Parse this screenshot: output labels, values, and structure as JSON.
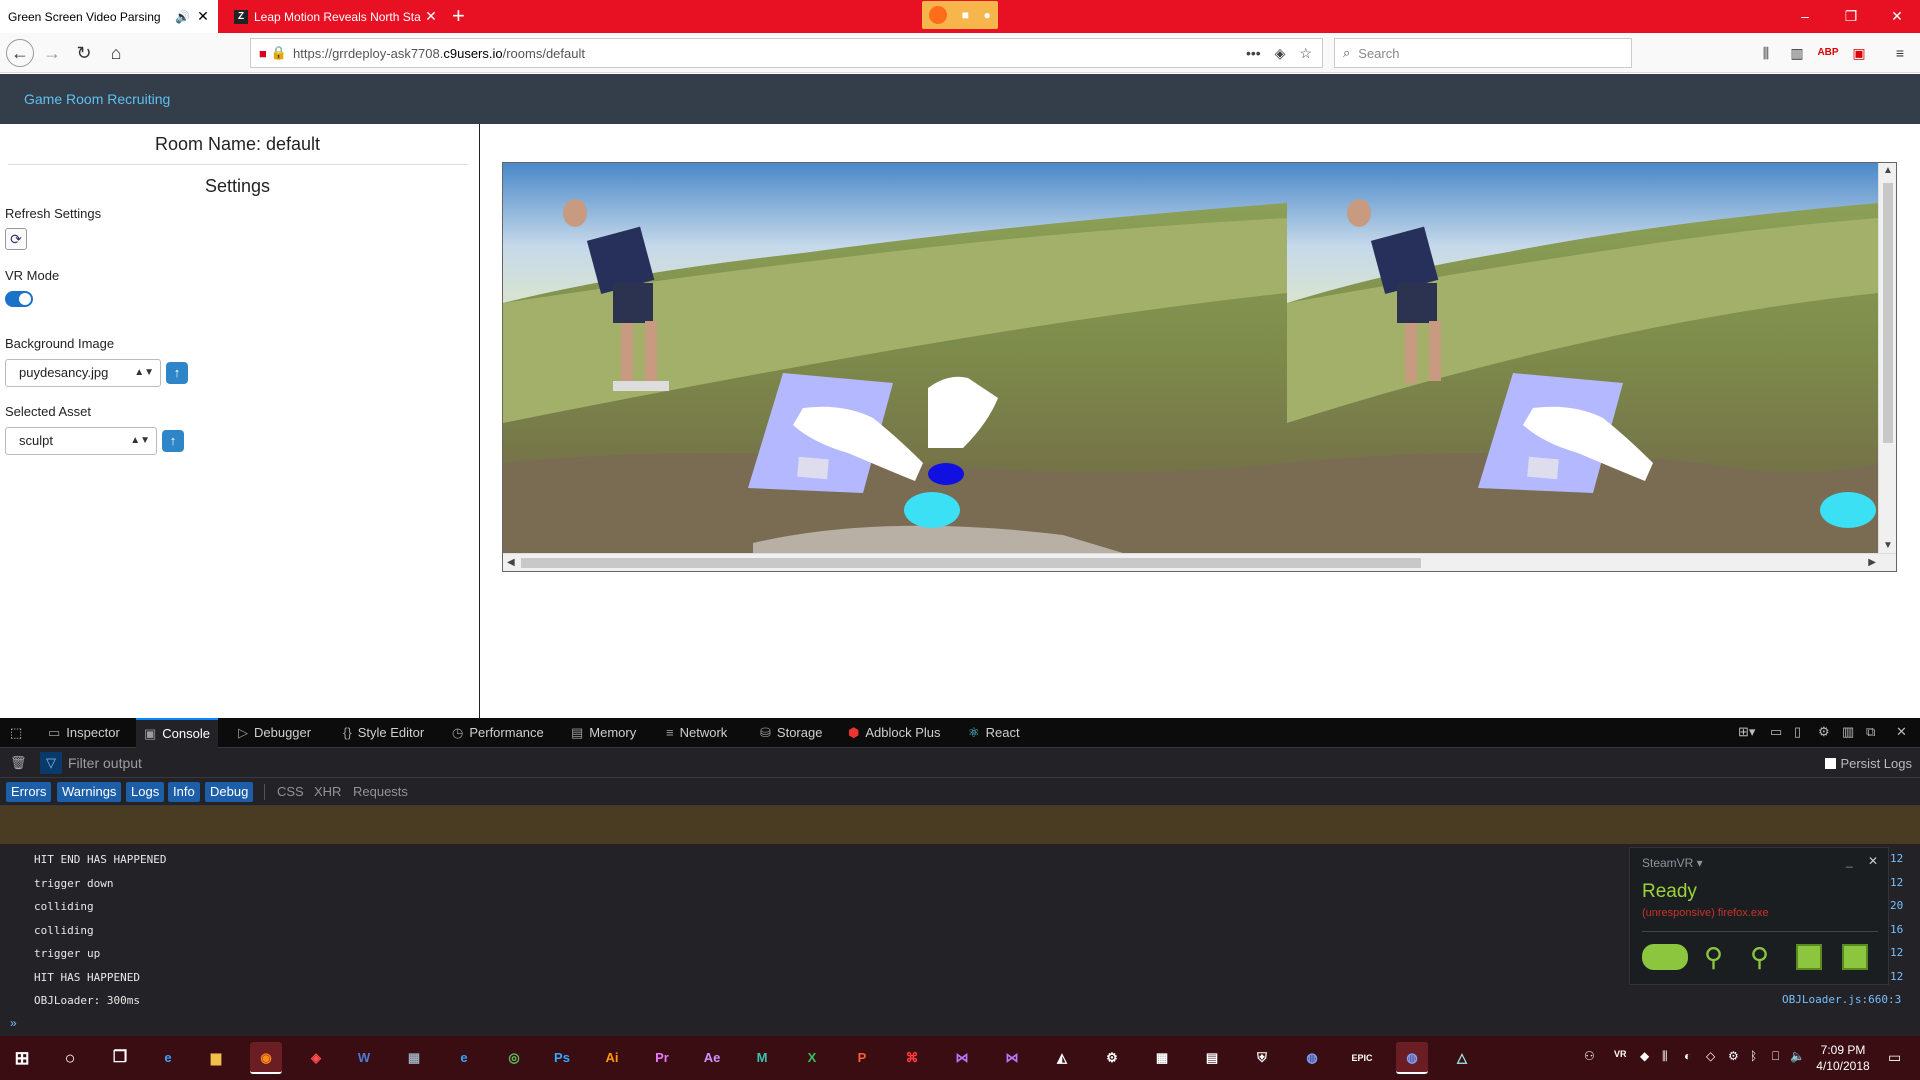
{
  "browser": {
    "tabs": [
      {
        "label": "Green Screen Video Parsing",
        "active": true
      },
      {
        "label": "Leap Motion Reveals North Sta",
        "active": false,
        "favicon": "Z"
      }
    ],
    "new_tab": "+",
    "url_prefix": "https://grrdeploy-ask7708.",
    "url_domain": "c9users.io",
    "url_path": "/rooms/default",
    "search_placeholder": "Search",
    "window_controls": {
      "minimize": "–",
      "restore": "❐",
      "close": "✕"
    }
  },
  "app": {
    "brand": "Game Room Recruiting",
    "room_name": "Room Name: default",
    "settings_title": "Settings",
    "refresh_label": "Refresh Settings",
    "vr_mode_label": "VR Mode",
    "vr_mode_on": true,
    "background_label": "Background Image",
    "background_value": "puydesancy.jpg",
    "asset_label": "Selected Asset",
    "asset_value": "sculpt"
  },
  "devtools": {
    "tabs": [
      {
        "label": "Inspector",
        "icon": "inspector-icon"
      },
      {
        "label": "Console",
        "icon": "console-icon",
        "active": true
      },
      {
        "label": "Debugger",
        "icon": "debugger-icon"
      },
      {
        "label": "Style Editor",
        "icon": "style-editor-icon"
      },
      {
        "label": "Performance",
        "icon": "performance-icon"
      },
      {
        "label": "Memory",
        "icon": "memory-icon"
      },
      {
        "label": "Network",
        "icon": "network-icon"
      },
      {
        "label": "Storage",
        "icon": "storage-icon"
      },
      {
        "label": "Adblock Plus",
        "icon": "adblock-icon"
      },
      {
        "label": "React",
        "icon": "react-icon"
      }
    ],
    "filter_placeholder": "Filter output",
    "persist_logs": "Persist Logs",
    "levels_on": [
      "Errors",
      "Warnings",
      "Logs",
      "Info",
      "Debug"
    ],
    "levels_off": [
      "CSS",
      "XHR",
      "Requests"
    ],
    "log_lines": [
      {
        "text": "HIT END HAS HAPPENED",
        "line": "12"
      },
      {
        "text": "trigger down",
        "line": "12"
      },
      {
        "text": "colliding",
        "line": "20"
      },
      {
        "text": "colliding",
        "line": "16"
      },
      {
        "text": "trigger up",
        "line": "12"
      },
      {
        "text": "HIT HAS HAPPENED",
        "line": "12"
      },
      {
        "text": "OBJLoader: 300ms",
        "line": ""
      }
    ],
    "source_ref": "OBJLoader.js:660:3",
    "prompt": "»"
  },
  "steamvr": {
    "title": "SteamVR ▾",
    "status": "Ready",
    "warning": "(unresponsive) firefox.exe",
    "minimize": "_",
    "close": "✕"
  },
  "taskbar": {
    "apps": [
      "Ps",
      "Ai",
      "Pr",
      "Ae",
      "M",
      "X",
      "P"
    ],
    "time": "7:09 PM",
    "date": "4/10/2018",
    "vr_badge": "VR"
  },
  "colors": {
    "tabbar": "#e81123",
    "appbar": "#343e4a",
    "brand": "#5ec1f0",
    "devtools_bg": "#232327",
    "steamvr_ready": "#9bd33b"
  }
}
